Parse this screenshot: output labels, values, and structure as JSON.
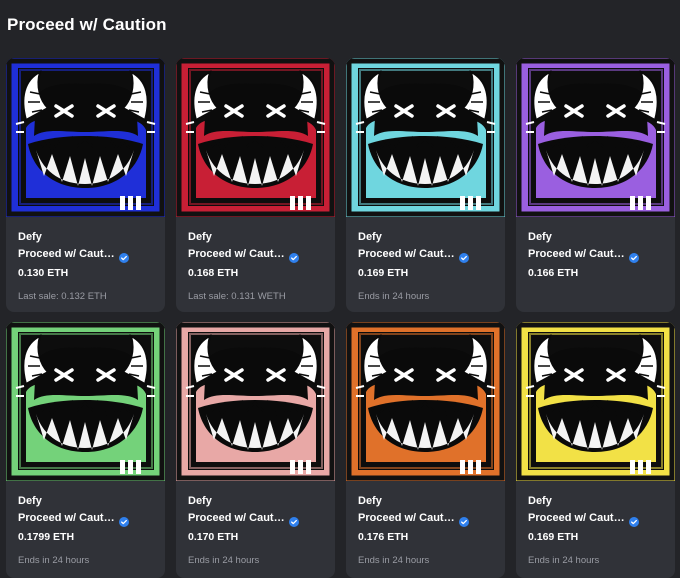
{
  "page": {
    "title": "Proceed w/ Caution"
  },
  "cards": [
    {
      "collection": "Defy",
      "name": "Proceed w/ Caut…",
      "price": "0.130 ETH",
      "sub": "Last sale: 0.132 ETH",
      "color": "#1f2fd8"
    },
    {
      "collection": "Defy",
      "name": "Proceed w/ Caut…",
      "price": "0.168 ETH",
      "sub": "Last sale: 0.131 WETH",
      "color": "#c81f35"
    },
    {
      "collection": "Defy",
      "name": "Proceed w/ Caut…",
      "price": "0.169 ETH",
      "sub": "Ends in 24 hours",
      "color": "#6fd6df"
    },
    {
      "collection": "Defy",
      "name": "Proceed w/ Caut…",
      "price": "0.166 ETH",
      "sub": "",
      "color": "#9a5fe0"
    },
    {
      "collection": "Defy",
      "name": "Proceed w/ Caut…",
      "price": "0.1799 ETH",
      "sub": "Ends in 24 hours",
      "color": "#74d27a"
    },
    {
      "collection": "Defy",
      "name": "Proceed w/ Caut…",
      "price": "0.170 ETH",
      "sub": "Ends in 24 hours",
      "color": "#e8a8a6"
    },
    {
      "collection": "Defy",
      "name": "Proceed w/ Caut…",
      "price": "0.176 ETH",
      "sub": "Ends in 24 hours",
      "color": "#e0712a"
    },
    {
      "collection": "Defy",
      "name": "Proceed w/ Caut…",
      "price": "0.169 ETH",
      "sub": "Ends in 24 hours",
      "color": "#f2e146"
    }
  ],
  "colors": {
    "background": "#232428",
    "card": "#303238",
    "verified": "#2f80ed",
    "muted_text": "#9a9ca4"
  },
  "icons": {
    "verified": "verified-badge-icon"
  }
}
